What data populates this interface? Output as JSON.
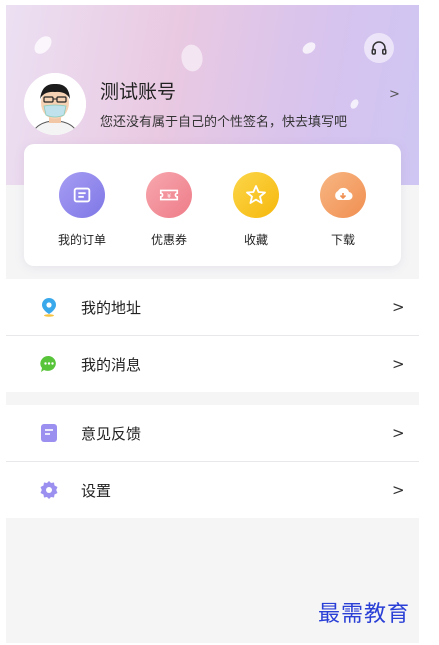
{
  "profile": {
    "name": "测试账号",
    "signature": "您还没有属于自己的个性签名，快去填写吧",
    "arrow": ">"
  },
  "quick_actions": [
    {
      "label": "我的订单",
      "icon": "order-icon",
      "color": "#8f86ec"
    },
    {
      "label": "优惠券",
      "icon": "coupon-icon",
      "color": "#f28f98"
    },
    {
      "label": "收藏",
      "icon": "star-icon",
      "color": "#f9c524"
    },
    {
      "label": "下载",
      "icon": "download-icon",
      "color": "#f5a26a"
    }
  ],
  "menu_group1": [
    {
      "label": "我的地址",
      "arrow": ">",
      "icon": "location-icon"
    },
    {
      "label": "我的消息",
      "arrow": ">",
      "icon": "message-icon"
    }
  ],
  "menu_group2": [
    {
      "label": "意见反馈",
      "arrow": ">",
      "icon": "feedback-icon"
    },
    {
      "label": "设置",
      "arrow": ">",
      "icon": "settings-icon"
    }
  ],
  "watermark": "最需教育",
  "colors": {
    "header_gradient_start": "#ece0f3",
    "header_gradient_end": "#cfc6f3",
    "background": "#f5f5f6"
  }
}
